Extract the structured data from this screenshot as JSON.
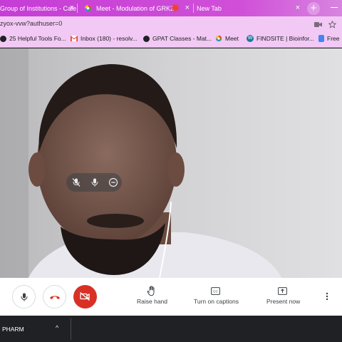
{
  "browser": {
    "tabs": [
      {
        "title": "Group of Institutions - Cale",
        "close": "×"
      },
      {
        "title": "Meet - Modulation of GRK2",
        "close": "×"
      },
      {
        "title": "New Tab",
        "close": "×"
      }
    ],
    "new_tab_symbol": "+",
    "url": "zyox-vvw?authuser=0",
    "bookmarks": [
      {
        "label": "25 Helpful Tools Fo...",
        "icon": "bookmark-globe-icon"
      },
      {
        "label": "Inbox (180) - resolv...",
        "icon": "gmail-icon"
      },
      {
        "label": "GPAT Classes - Mat...",
        "icon": "bookmark-globe-icon"
      },
      {
        "label": "Meet",
        "icon": "meet-icon"
      },
      {
        "label": "FINDSITE | Bioinfor...",
        "icon": "wordpress-icon"
      },
      {
        "label": "Free",
        "icon": "bookmark-icon"
      }
    ]
  },
  "meet": {
    "participant_overlay": [
      "mic-off-icon",
      "mic-icon",
      "remove-icon"
    ],
    "controls": {
      "raise_hand": "Raise hand",
      "captions": "Turn on captions",
      "present": "Present now"
    },
    "colors": {
      "end_call": "#d93025",
      "camera_off": "#d93025"
    }
  },
  "taskbar": {
    "label": "PHARM",
    "chevron": "^"
  }
}
